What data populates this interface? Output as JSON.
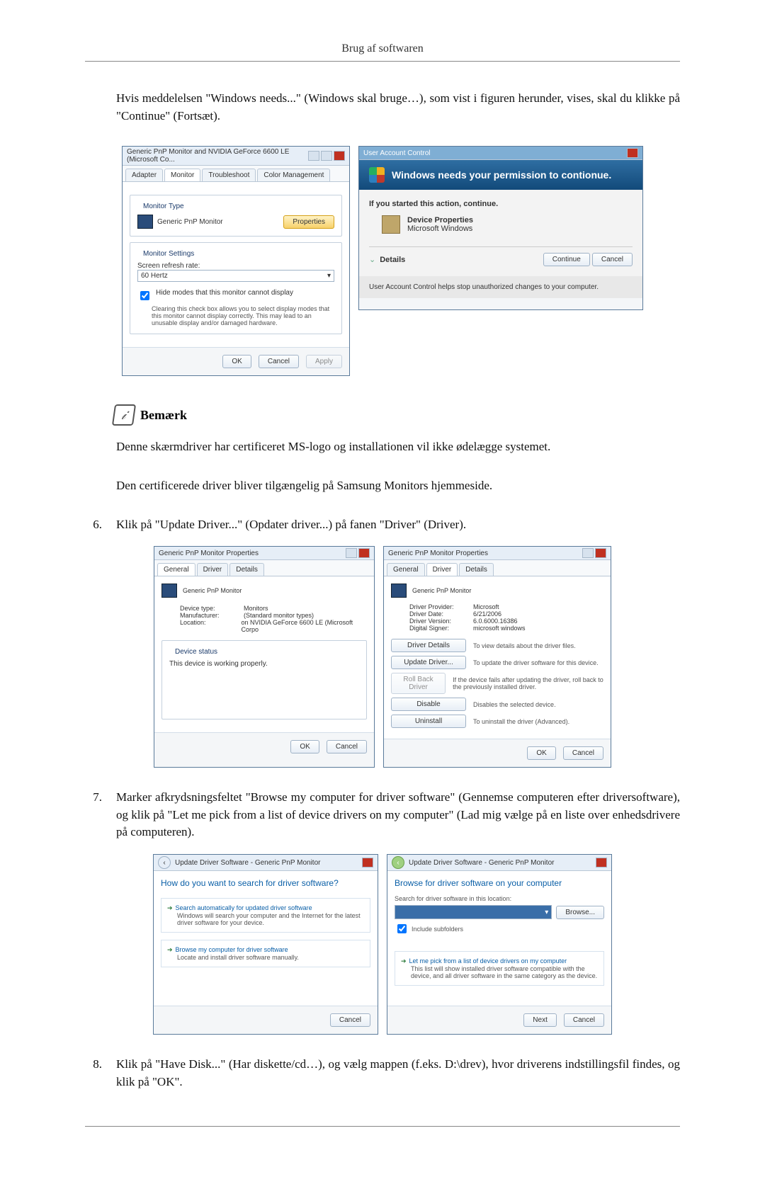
{
  "header": {
    "title": "Brug af softwaren"
  },
  "intro": "Hvis meddelelsen \"Windows needs...\" (Windows skal bruge…), som vist i figuren herunder, vises, skal du klikke på \"Continue\" (Fortsæt).",
  "monitor_dialog": {
    "title": "Generic PnP Monitor and NVIDIA GeForce 6600 LE (Microsoft Co...",
    "tabs": [
      "Adapter",
      "Monitor",
      "Troubleshoot",
      "Color Management"
    ],
    "monitor_type_label": "Monitor Type",
    "monitor_name": "Generic PnP Monitor",
    "properties_btn": "Properties",
    "settings_label": "Monitor Settings",
    "refresh_label": "Screen refresh rate:",
    "refresh_value": "60 Hertz",
    "hide_modes": "Hide modes that this monitor cannot display",
    "hide_desc": "Clearing this check box allows you to select display modes that this monitor cannot display correctly. This may lead to an unusable display and/or damaged hardware.",
    "ok": "OK",
    "cancel": "Cancel",
    "apply": "Apply"
  },
  "uac": {
    "titlebar": "User Account Control",
    "headline": "Windows needs your permission to contionue.",
    "if_started": "If you started this action, continue.",
    "item_title": "Device Properties",
    "item_sub": "Microsoft Windows",
    "details": "Details",
    "continue": "Continue",
    "cancel": "Cancel",
    "footer": "User Account Control helps stop unauthorized changes to your computer."
  },
  "note": {
    "label": "Bemærk"
  },
  "note_text1": "Denne skærmdriver har certificeret MS-logo og installationen vil ikke ødelægge systemet.",
  "note_text2": "Den certificerede driver bliver tilgængelig på Samsung Monitors hjemmeside.",
  "step6": {
    "num": "6.",
    "text": "Klik på \"Update Driver...\" (Opdater driver...) på fanen \"Driver\" (Driver)."
  },
  "props_left": {
    "title": "Generic PnP Monitor Properties",
    "tabs": [
      "General",
      "Driver",
      "Details"
    ],
    "name": "Generic PnP Monitor",
    "rows": {
      "dt_l": "Device type:",
      "dt_v": "Monitors",
      "mf_l": "Manufacturer:",
      "mf_v": "(Standard monitor types)",
      "lo_l": "Location:",
      "lo_v": "on NVIDIA GeForce 6600 LE (Microsoft Corpo"
    },
    "status_label": "Device status",
    "status_text": "This device is working properly.",
    "ok": "OK",
    "cancel": "Cancel"
  },
  "props_right": {
    "title": "Generic PnP Monitor Properties",
    "tabs": [
      "General",
      "Driver",
      "Details"
    ],
    "name": "Generic PnP Monitor",
    "rows": {
      "dp_l": "Driver Provider:",
      "dp_v": "Microsoft",
      "dd_l": "Driver Date:",
      "dd_v": "6/21/2006",
      "dv_l": "Driver Version:",
      "dv_v": "6.0.6000.16386",
      "ds_l": "Digital Signer:",
      "ds_v": "microsoft windows"
    },
    "btns": {
      "details": "Driver Details",
      "details_d": "To view details about the driver files.",
      "update": "Update Driver...",
      "update_d": "To update the driver software for this device.",
      "rollback": "Roll Back Driver",
      "rollback_d": "If the device fails after updating the driver, roll back to the previously installed driver.",
      "disable": "Disable",
      "disable_d": "Disables the selected device.",
      "uninstall": "Uninstall",
      "uninstall_d": "To uninstall the driver (Advanced)."
    },
    "ok": "OK",
    "cancel": "Cancel"
  },
  "step7": {
    "num": "7.",
    "text": "Marker afkrydsningsfeltet \"Browse my computer for driver software\" (Gennemse computeren efter driversoftware), og klik på \"Let me pick from a list of device drivers on my computer\" (Lad mig vælge på en liste over enhedsdrivere på computeren)."
  },
  "wiz_left": {
    "title": "Update Driver Software - Generic PnP Monitor",
    "heading": "How do you want to search for driver software?",
    "opt1": "Search automatically for updated driver software",
    "opt1_d": "Windows will search your computer and the Internet for the latest driver software for your device.",
    "opt2": "Browse my computer for driver software",
    "opt2_d": "Locate and install driver software manually.",
    "cancel": "Cancel"
  },
  "wiz_right": {
    "title": "Update Driver Software - Generic PnP Monitor",
    "heading": "Browse for driver software on your computer",
    "search_label": "Search for driver software in this location:",
    "browse": "Browse...",
    "include": "Include subfolders",
    "pick": "Let me pick from a list of device drivers on my computer",
    "pick_d": "This list will show installed driver software compatible with the device, and all driver software in the same category as the device.",
    "next": "Next",
    "cancel": "Cancel"
  },
  "step8": {
    "num": "8.",
    "text": "Klik på \"Have Disk...\" (Har diskette/cd…), og vælg mappen (f.eks. D:\\drev), hvor driverens indstillingsfil findes, og klik på \"OK\"."
  }
}
